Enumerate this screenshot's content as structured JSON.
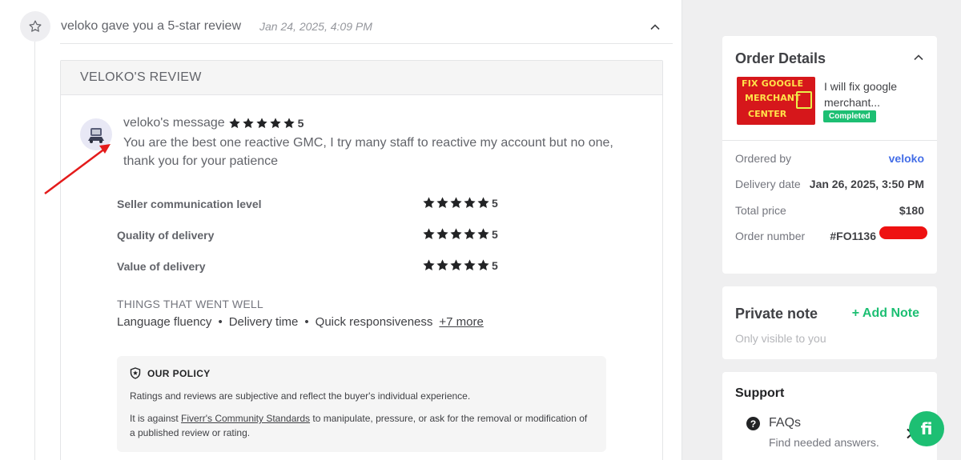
{
  "event": {
    "actor": "veloko",
    "title": "veloko gave you a 5-star review",
    "date": "Jan 24, 2025, 4:09 PM"
  },
  "review": {
    "card_title": "VELOKO'S REVIEW",
    "message_label": "veloko's message",
    "rating": "5",
    "message": "You are the best one reactive GMC, I try many staff to reactive my account but no one, thank you for your patience",
    "criteria": [
      {
        "label": "Seller communication level",
        "rating": "5"
      },
      {
        "label": "Quality of delivery",
        "rating": "5"
      },
      {
        "label": "Value of delivery",
        "rating": "5"
      }
    ],
    "went_well_title": "THINGS THAT WENT WELL",
    "went_well": [
      "Language fluency",
      "Delivery time",
      "Quick responsiveness"
    ],
    "more_link": "+7 more"
  },
  "policy": {
    "title": "OUR POLICY",
    "p1": "Ratings and reviews are subjective and reflect the buyer's individual experience.",
    "p2_before": "It is against ",
    "p2_link": "Fiverr's Community Standards",
    "p2_after": " to manipulate, pressure, or ask for the removal or modification of a published review or rating."
  },
  "order": {
    "title": "Order Details",
    "gig_title": "I will fix google merchant...",
    "gig_thumb_lines": [
      "FIX GOOGLE",
      "MERCHANT",
      "CENTER"
    ],
    "status": "Completed",
    "rows": [
      {
        "key": "Ordered by",
        "value": "veloko"
      },
      {
        "key": "Delivery date",
        "value": "Jan 26, 2025, 3:50 PM"
      },
      {
        "key": "Total price",
        "value": "$180"
      },
      {
        "key": "Order number",
        "value": "#FO1136"
      }
    ]
  },
  "note": {
    "title": "Private note",
    "add_label": "+ Add Note",
    "subtitle": "Only visible to you"
  },
  "support": {
    "title": "Support",
    "faq_title": "FAQs",
    "faq_sub": "Find needed answers."
  },
  "fab_label": "fi",
  "colors": {
    "brand_green": "#1dbf73",
    "link_blue": "#446ee7",
    "annotation_red": "#e41b1b"
  }
}
